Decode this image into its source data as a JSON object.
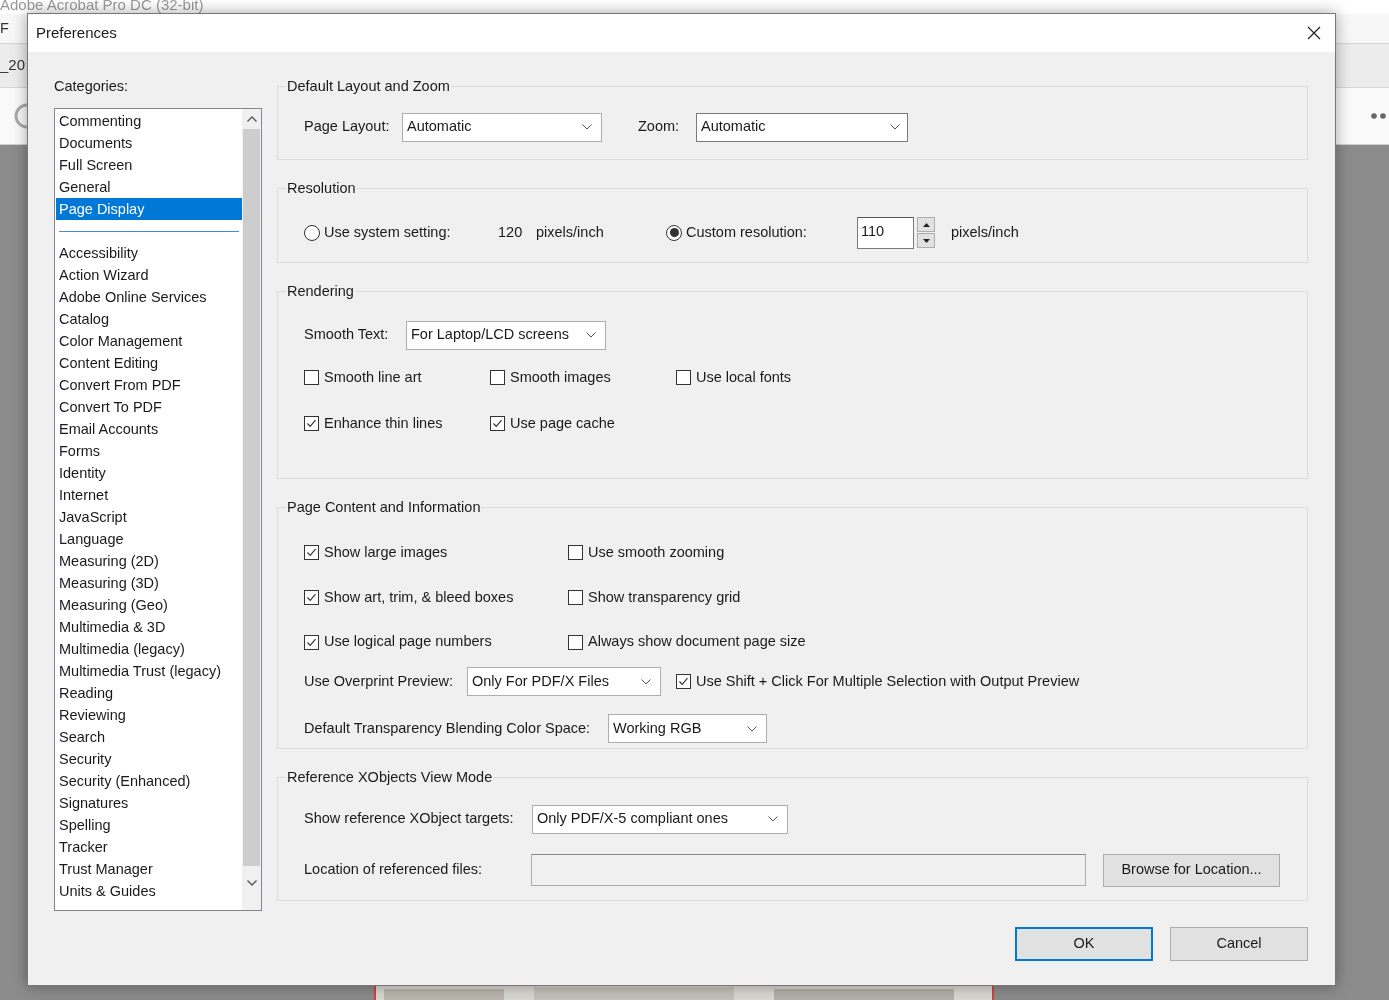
{
  "background_app": {
    "title": "Adobe Acrobat Pro DC (32-bit)",
    "menu_fragments": [
      "F"
    ],
    "tab_fragment": "_20"
  },
  "window": {
    "title": "Preferences"
  },
  "categories": {
    "label": "Categories:",
    "groups": [
      [
        {
          "label": "Commenting",
          "selected": false
        },
        {
          "label": "Documents",
          "selected": false
        },
        {
          "label": "Full Screen",
          "selected": false
        },
        {
          "label": "General",
          "selected": false
        },
        {
          "label": "Page Display",
          "selected": true
        }
      ],
      [
        {
          "label": "Accessibility",
          "selected": false
        },
        {
          "label": "Action Wizard",
          "selected": false
        },
        {
          "label": "Adobe Online Services",
          "selected": false
        },
        {
          "label": "Catalog",
          "selected": false
        },
        {
          "label": "Color Management",
          "selected": false
        },
        {
          "label": "Content Editing",
          "selected": false
        },
        {
          "label": "Convert From PDF",
          "selected": false
        },
        {
          "label": "Convert To PDF",
          "selected": false
        },
        {
          "label": "Email Accounts",
          "selected": false
        },
        {
          "label": "Forms",
          "selected": false
        },
        {
          "label": "Identity",
          "selected": false
        },
        {
          "label": "Internet",
          "selected": false
        },
        {
          "label": "JavaScript",
          "selected": false
        },
        {
          "label": "Language",
          "selected": false
        },
        {
          "label": "Measuring (2D)",
          "selected": false
        },
        {
          "label": "Measuring (3D)",
          "selected": false
        },
        {
          "label": "Measuring (Geo)",
          "selected": false
        },
        {
          "label": "Multimedia & 3D",
          "selected": false
        },
        {
          "label": "Multimedia (legacy)",
          "selected": false
        },
        {
          "label": "Multimedia Trust (legacy)",
          "selected": false
        },
        {
          "label": "Reading",
          "selected": false
        },
        {
          "label": "Reviewing",
          "selected": false
        },
        {
          "label": "Search",
          "selected": false
        },
        {
          "label": "Security",
          "selected": false
        },
        {
          "label": "Security (Enhanced)",
          "selected": false
        },
        {
          "label": "Signatures",
          "selected": false
        },
        {
          "label": "Spelling",
          "selected": false
        },
        {
          "label": "Tracker",
          "selected": false
        },
        {
          "label": "Trust Manager",
          "selected": false
        },
        {
          "label": "Units & Guides",
          "selected": false
        }
      ]
    ]
  },
  "layout_zoom": {
    "title": "Default Layout and Zoom",
    "page_layout": {
      "label": "Page Layout:",
      "value": "Automatic"
    },
    "zoom": {
      "label": "Zoom:",
      "value": "Automatic"
    }
  },
  "resolution": {
    "title": "Resolution",
    "system": {
      "label": "Use system setting:",
      "selected": false,
      "reading": "120",
      "unit": "pixels/inch"
    },
    "custom": {
      "label": "Custom resolution:",
      "selected": true,
      "value": "110",
      "unit": "pixels/inch"
    }
  },
  "rendering": {
    "title": "Rendering",
    "smooth_text": {
      "label": "Smooth Text:",
      "value": "For Laptop/LCD screens"
    },
    "checkboxes": [
      {
        "label": "Smooth line art",
        "checked": false
      },
      {
        "label": "Smooth images",
        "checked": false
      },
      {
        "label": "Use local fonts",
        "checked": false
      },
      {
        "label": "Enhance thin lines",
        "checked": true
      },
      {
        "label": "Use page cache",
        "checked": true
      }
    ]
  },
  "page_content": {
    "title": "Page Content and Information",
    "checkboxes": [
      {
        "label": "Show large images",
        "checked": true
      },
      {
        "label": "Use smooth zooming",
        "checked": false
      },
      {
        "label": "Show art, trim, & bleed boxes",
        "checked": true
      },
      {
        "label": "Show transparency grid",
        "checked": false
      },
      {
        "label": "Use logical page numbers",
        "checked": true
      },
      {
        "label": "Always show document page size",
        "checked": false
      }
    ],
    "overprint": {
      "label": "Use Overprint Preview:",
      "value": "Only For PDF/X Files"
    },
    "shift_click": {
      "label": "Use Shift + Click For Multiple Selection with Output Preview",
      "checked": true
    },
    "blending": {
      "label": "Default Transparency Blending Color Space:",
      "value": "Working RGB"
    }
  },
  "xobjects": {
    "title": "Reference XObjects View Mode",
    "targets": {
      "label": "Show reference XObject targets:",
      "value": "Only PDF/X-5 compliant ones"
    },
    "location": {
      "label": "Location of referenced files:"
    },
    "browse": "Browse for Location..."
  },
  "buttons": [
    {
      "label": "OK",
      "default": true
    },
    {
      "label": "Cancel",
      "default": false
    }
  ]
}
